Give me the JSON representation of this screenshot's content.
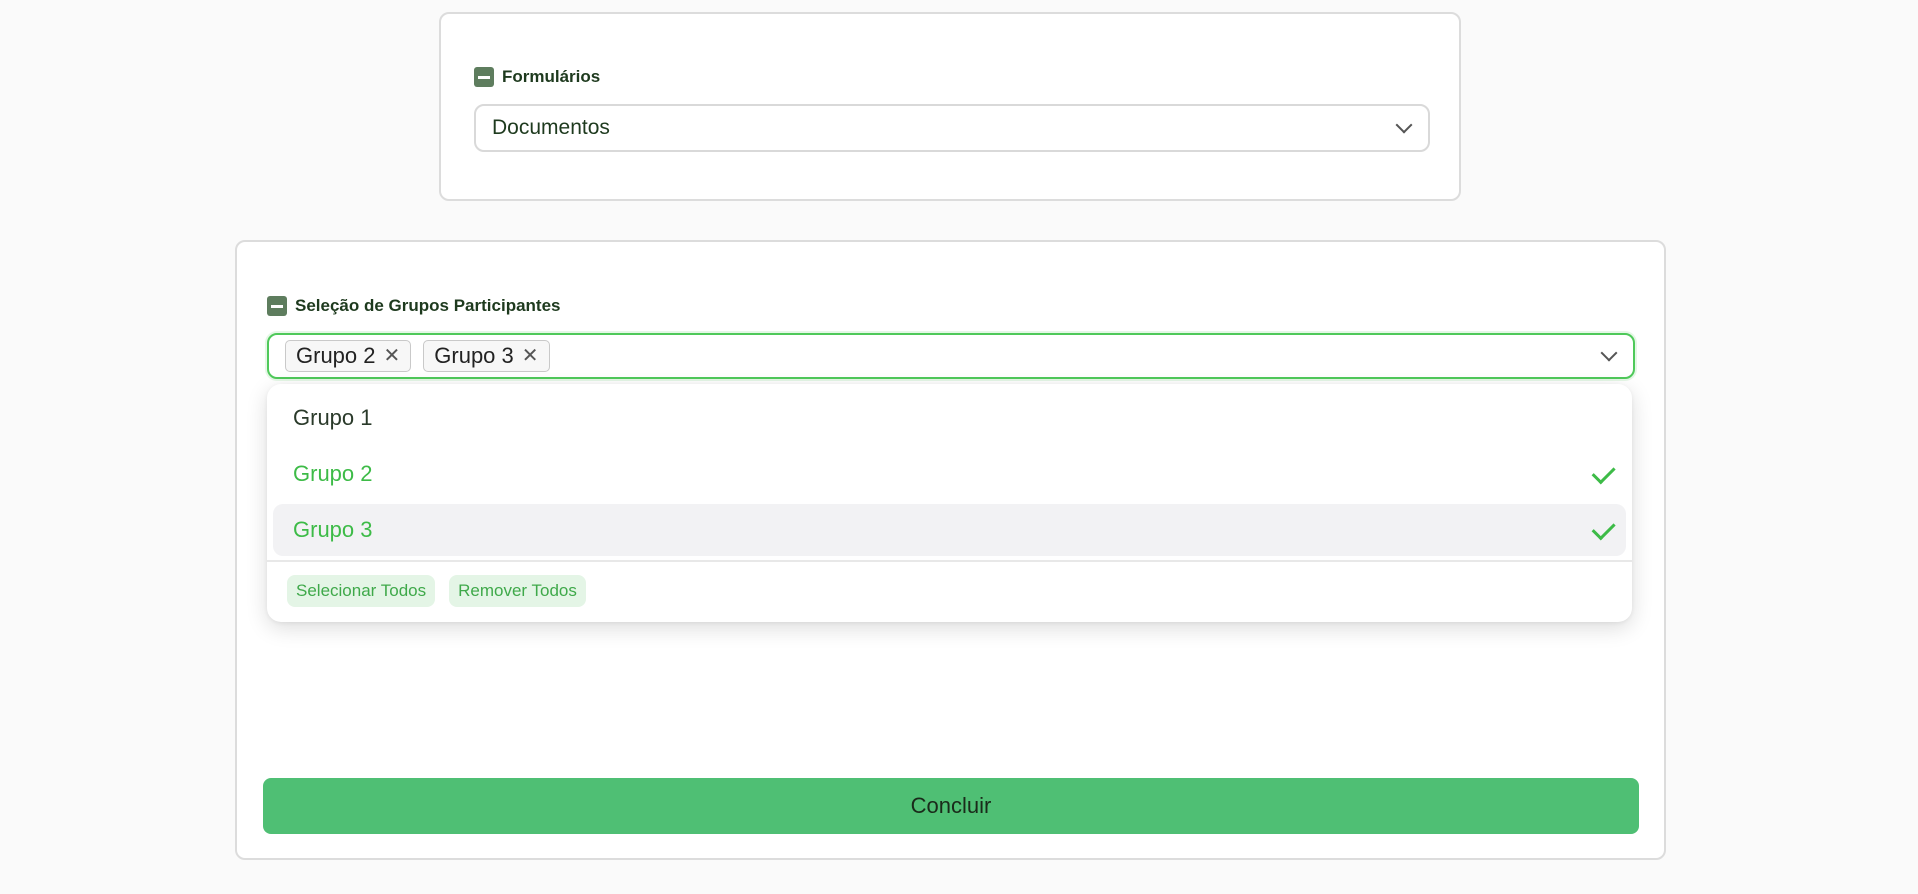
{
  "forms_section": {
    "label": "Formulários",
    "selected_value": "Documentos"
  },
  "groups_section": {
    "label": "Seleção de Grupos Participantes",
    "tags": [
      "Grupo 2",
      "Grupo 3"
    ],
    "dropdown": {
      "options": [
        {
          "label": "Grupo 1",
          "selected": false
        },
        {
          "label": "Grupo 2",
          "selected": true
        },
        {
          "label": "Grupo 3",
          "selected": true
        }
      ],
      "select_all_label": "Selecionar Todos",
      "remove_all_label": "Remover Todos"
    }
  },
  "submit_label": "Concluir",
  "colors": {
    "accent": "#3dbb47",
    "button": "#4fbf74",
    "section_icon": "#5e7d5e"
  }
}
